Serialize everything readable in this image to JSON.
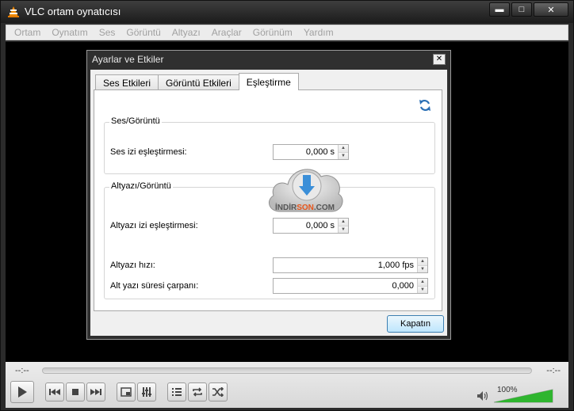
{
  "window": {
    "title": "VLC ortam oynatıcısı",
    "buttons": {
      "minimize": "▬",
      "maximize": "□",
      "close": "✕"
    }
  },
  "menu": [
    "Ortam",
    "Oynatım",
    "Ses",
    "Görüntü",
    "Altyazı",
    "Araçlar",
    "Görünüm",
    "Yardım"
  ],
  "dialog": {
    "title": "Ayarlar ve Etkiler",
    "close_glyph": "✕",
    "tabs": [
      "Ses Etkileri",
      "Görüntü Etkileri",
      "Eşleştirme"
    ],
    "active_tab": "Eşleştirme",
    "audio_video": {
      "group_title": "Ses/Görüntü",
      "audio_sync_label": "Ses izi eşleştirmesi:",
      "audio_sync_value": "0,000 s"
    },
    "subtitles_video": {
      "group_title": "Altyazı/Görüntü",
      "subtitle_sync_label": "Altyazı izi eşleştirmesi:",
      "subtitle_sync_value": "0,000 s",
      "subtitle_speed_label": "Altyazı hızı:",
      "subtitle_speed_value": "1,000 fps",
      "subtitle_duration_label": "Alt yazı süresi çarpanı:",
      "subtitle_duration_value": "0,000"
    },
    "close_button": "Kapatın"
  },
  "player": {
    "time_elapsed": "--:--",
    "time_total": "--:--",
    "volume_percent": "100%",
    "volume_level": 1.0
  },
  "watermark": {
    "text_a": "İNDİR",
    "text_b": "SON",
    "text_c": ".COM"
  },
  "colors": {
    "accent": "#3c7fb1",
    "volume_green": "#2fb52f",
    "watermark_orange": "#e8561c"
  }
}
